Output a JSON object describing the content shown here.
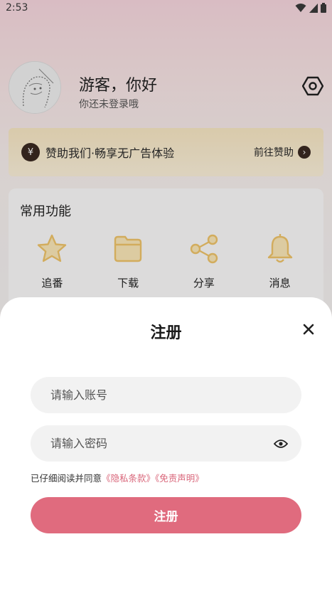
{
  "status_bar": {
    "time": "2:53"
  },
  "profile": {
    "greeting": "游客，你好",
    "subtitle": "你还未登录哦"
  },
  "sponsor": {
    "icon_glyph": "¥",
    "text": "赞助我们·畅享无广告体验",
    "link_label": "前往赞助"
  },
  "features": {
    "title": "常用功能",
    "items": [
      {
        "label": "追番",
        "icon": "star-icon"
      },
      {
        "label": "下载",
        "icon": "folder-icon"
      },
      {
        "label": "分享",
        "icon": "share-icon"
      },
      {
        "label": "消息",
        "icon": "bell-icon"
      }
    ]
  },
  "register_sheet": {
    "title": "注册",
    "account_placeholder": "请输入账号",
    "password_placeholder": "请输入密码",
    "agreement_prefix": "已仔细阅读并同意",
    "privacy_link": "《隐私条款》",
    "disclaimer_link": "《免责声明》",
    "submit_label": "注册"
  },
  "colors": {
    "accent": "#e06b7e",
    "link": "#d9667a",
    "icon_gold": "#f0c46a",
    "sponsor_bg": "#f8e7c3"
  }
}
